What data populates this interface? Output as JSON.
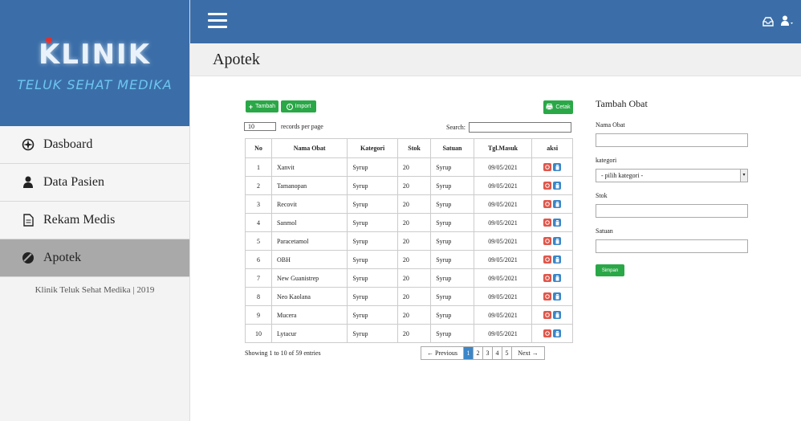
{
  "sidebar": {
    "logo_title": "KLINIK",
    "logo_subtitle": "TELUK SEHAT MEDIKA",
    "items": [
      {
        "label": "Dasboard"
      },
      {
        "label": "Data Pasien"
      },
      {
        "label": "Rekam Medis"
      },
      {
        "label": "Apotek"
      }
    ],
    "footer": "Klinik Teluk Sehat Medika | 2019"
  },
  "header": {
    "page_title": "Apotek"
  },
  "toolbar": {
    "add_label": "Tambah",
    "import_label": "Import",
    "print_label": "Cetak",
    "records_value": "10",
    "records_label": "records per page",
    "search_label": "Search:"
  },
  "table": {
    "headers": [
      "No",
      "Nama Obat",
      "Kategori",
      "Stok",
      "Satuan",
      "Tgl.Masuk",
      "aksi"
    ],
    "rows": [
      [
        "1",
        "Xanvit",
        "Syrup",
        "20",
        "Syrup",
        "09/05/2021"
      ],
      [
        "2",
        "Tamanopan",
        "Syrup",
        "20",
        "Syrup",
        "09/05/2021"
      ],
      [
        "3",
        "Recovit",
        "Syrup",
        "20",
        "Syrup",
        "09/05/2021"
      ],
      [
        "4",
        "Sanmol",
        "Syrup",
        "20",
        "Syrup",
        "09/05/2021"
      ],
      [
        "5",
        "Paracetamol",
        "Syrup",
        "20",
        "Syrup",
        "09/05/2021"
      ],
      [
        "6",
        "OBH",
        "Syrup",
        "20",
        "Syrup",
        "09/05/2021"
      ],
      [
        "7",
        "New Guanistrep",
        "Syrup",
        "20",
        "Syrup",
        "09/05/2021"
      ],
      [
        "8",
        "Neo Kaolana",
        "Syrup",
        "20",
        "Syrup",
        "09/05/2021"
      ],
      [
        "9",
        "Mucera",
        "Syrup",
        "20",
        "Syrup",
        "09/05/2021"
      ],
      [
        "10",
        "Lytacur",
        "Syrup",
        "20",
        "Syrup",
        "09/05/2021"
      ]
    ],
    "showing": "Showing 1 to 10 of 59 entries"
  },
  "pagination": {
    "previous": "← Previous",
    "pages": [
      "1",
      "2",
      "3",
      "4",
      "5"
    ],
    "current": "1",
    "next": "Next →"
  },
  "form": {
    "title": "Tambah Obat",
    "nama_label": "Nama Obat",
    "kategori_label": "kategori",
    "kategori_selected": "- pilih kategori -",
    "stok_label": "Stok",
    "satuan_label": "Satuan",
    "submit_label": "Simpan"
  },
  "colors": {
    "header_bg": "#3b6ea8",
    "button_green": "#2aa847",
    "delete_red": "#e0564a",
    "edit_blue": "#3b86c8"
  }
}
